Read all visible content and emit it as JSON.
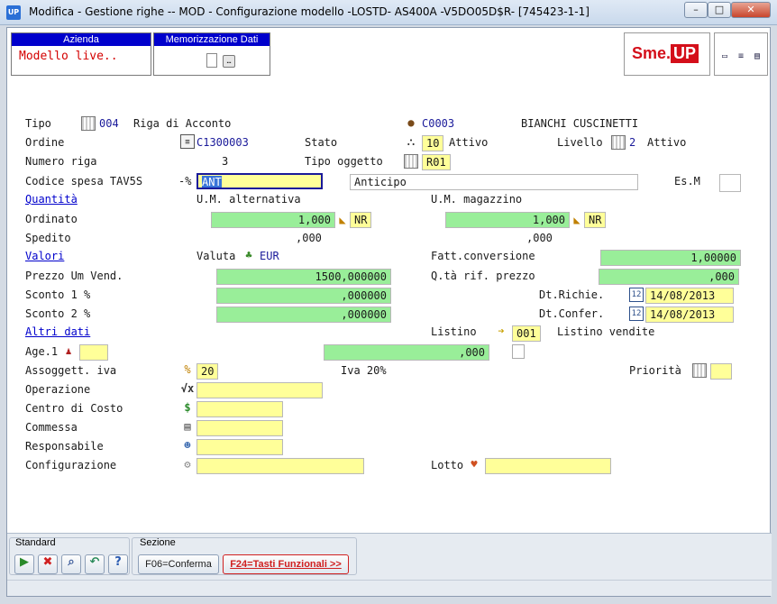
{
  "window": {
    "title": "Modifica -  Gestione righe -- MOD - Configurazione modello -LOSTD- AS400A -V5DO05D$R- [745423-1-1]",
    "app_icon": "UP",
    "buttons": {
      "minimize": "–",
      "maximize": "□",
      "close": "✕"
    }
  },
  "header": {
    "azienda_label": "Azienda",
    "azienda_value": "Modello live..",
    "memo_label": "Memorizzazione Dati Video",
    "logo_text": "Sme.",
    "logo_up": "UP"
  },
  "form": {
    "tipo": {
      "label": "Tipo",
      "code": "004",
      "desc": "Riga di Acconto",
      "icon": "grid-icon"
    },
    "cliente": {
      "code": "C0003",
      "name": "BIANCHI CUSCINETTI",
      "icon": "person-icon"
    },
    "ordine": {
      "label": "Ordine",
      "value": "C1300003",
      "icon": "document-icon"
    },
    "stato": {
      "label": "Stato",
      "code": "10",
      "desc": "Attivo",
      "icon": "hierarchy-icon"
    },
    "livello": {
      "label": "Livello",
      "code": "2",
      "desc": "Attivo"
    },
    "numero_riga": {
      "label": "Numero riga",
      "value": "3"
    },
    "tipo_oggetto": {
      "label": "Tipo oggetto",
      "value": "R01"
    },
    "codice_spesa": {
      "label": "Codice spesa TAV5S",
      "prefix": "-%",
      "value": "ANT",
      "desc": "Anticipo"
    },
    "esm": {
      "label": "Es.M"
    },
    "quantita": {
      "label": "Quantità",
      "um_alt": "U.M. alternativa",
      "um_mag": "U.M. magazzino"
    },
    "ordinato": {
      "label": "Ordinato",
      "value_alt": "1,000",
      "um_alt": "NR",
      "value_mag": "1,000",
      "um_mag": "NR"
    },
    "spedito": {
      "label": "Spedito",
      "value_alt": ",000",
      "value_mag": ",000"
    },
    "valori": {
      "label": "Valori",
      "valuta_label": "Valuta",
      "valuta": "EUR",
      "fatt_label": "Fatt.conversione",
      "fatt_value": "1,00000"
    },
    "prezzo": {
      "label": "Prezzo Um Vend.",
      "value": "1500,000000",
      "qrif_label": "Q.tà rif. prezzo",
      "qrif_value": ",000"
    },
    "sconto1": {
      "label": "Sconto 1 %",
      "value": ",000000",
      "date_label": "Dt.Richie.",
      "date_value": "14/08/2013"
    },
    "sconto2": {
      "label": "Sconto 2 %",
      "value": ",000000",
      "date_label": "Dt.Confer.",
      "date_value": "14/08/2013"
    },
    "altri_dati": {
      "label": "Altri dati",
      "listino_label": "Listino",
      "listino_code": "001",
      "listino_desc": "Listino vendite"
    },
    "age1": {
      "label": "Age.1",
      "value": "",
      "amount": ",000"
    },
    "iva": {
      "label": "Assoggett. iva",
      "code": "20",
      "desc": "Iva 20%",
      "priorita_label": "Priorità"
    },
    "operazione": {
      "label": "Operazione"
    },
    "centro_costo": {
      "label": "Centro di Costo"
    },
    "commessa": {
      "label": "Commessa"
    },
    "responsabile": {
      "label": "Responsabile"
    },
    "configurazione": {
      "label": "Configurazione",
      "lotto_label": "Lotto"
    }
  },
  "bottom": {
    "standard_label": "Standard",
    "sezione_label": "Sezione",
    "f06": "F06=Conferma",
    "f24": "F24=Tasti Funzionali >>"
  },
  "colors": {
    "accent_blue": "#0000cc",
    "input_yellow": "#ffff99",
    "input_green": "#99ee99",
    "logo_red": "#d40f1a"
  }
}
